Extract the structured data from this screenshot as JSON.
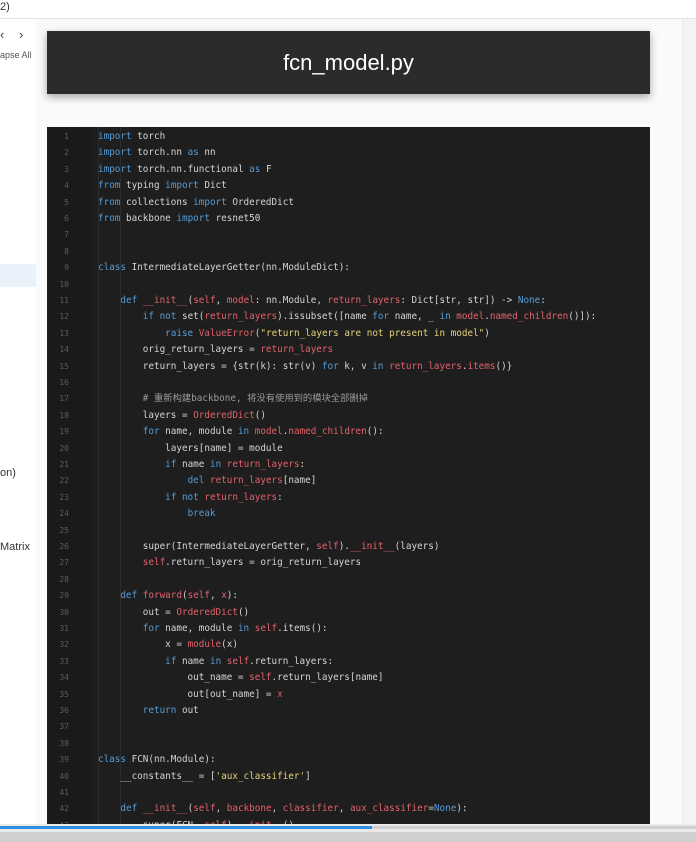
{
  "window": {
    "title_fragment": "2)"
  },
  "sidebar": {
    "back_glyph": "‹",
    "forward_glyph": "›",
    "collapse_label": "apse All",
    "item_on": "on)",
    "item_matrix": "Matrix"
  },
  "document": {
    "title": "fcn_model.py"
  },
  "code": {
    "language": "python",
    "lines": [
      [
        [
          "kw",
          "import"
        ],
        [
          "t",
          " torch"
        ]
      ],
      [
        [
          "kw",
          "import"
        ],
        [
          "t",
          " torch.nn "
        ],
        [
          "kw",
          "as"
        ],
        [
          "t",
          " nn"
        ]
      ],
      [
        [
          "kw",
          "import"
        ],
        [
          "t",
          " torch.nn.functional "
        ],
        [
          "kw",
          "as"
        ],
        [
          "t",
          " F"
        ]
      ],
      [
        [
          "kw",
          "from"
        ],
        [
          "t",
          " typing "
        ],
        [
          "kw",
          "import"
        ],
        [
          "t",
          " Dict"
        ]
      ],
      [
        [
          "kw",
          "from"
        ],
        [
          "t",
          " collections "
        ],
        [
          "kw",
          "import"
        ],
        [
          "t",
          " OrderedDict"
        ]
      ],
      [
        [
          "kw",
          "from"
        ],
        [
          "t",
          " backbone "
        ],
        [
          "kw",
          "import"
        ],
        [
          "t",
          " resnet50"
        ]
      ],
      [],
      [],
      [
        [
          "kw",
          "class"
        ],
        [
          "t",
          " IntermediateLayerGetter(nn.ModuleDict):"
        ]
      ],
      [],
      [
        [
          "t",
          "    "
        ],
        [
          "kw",
          "def"
        ],
        [
          "t",
          " "
        ],
        [
          "red",
          "__init__"
        ],
        [
          "t",
          "("
        ],
        [
          "red",
          "self"
        ],
        [
          "t",
          ", "
        ],
        [
          "red",
          "model"
        ],
        [
          "t",
          ": nn.Module, "
        ],
        [
          "red",
          "return_layers"
        ],
        [
          "t",
          ": Dict[str, str]) -> "
        ],
        [
          "kw",
          "None"
        ],
        [
          "t",
          ":"
        ]
      ],
      [
        [
          "t",
          "        "
        ],
        [
          "kw",
          "if not"
        ],
        [
          "t",
          " set("
        ],
        [
          "red",
          "return_layers"
        ],
        [
          "t",
          ").issubset([name "
        ],
        [
          "kw",
          "for"
        ],
        [
          "t",
          " name, _ "
        ],
        [
          "kw",
          "in"
        ],
        [
          "t",
          " "
        ],
        [
          "red",
          "model"
        ],
        [
          "t",
          "."
        ],
        [
          "red",
          "named_children"
        ],
        [
          "t",
          "()]):"
        ]
      ],
      [
        [
          "t",
          "            "
        ],
        [
          "kw",
          "raise"
        ],
        [
          "t",
          " "
        ],
        [
          "red",
          "ValueError"
        ],
        [
          "t",
          "("
        ],
        [
          "str",
          "\"return_layers are not present in model\""
        ],
        [
          "t",
          ")"
        ]
      ],
      [
        [
          "t",
          "        orig_return_layers = "
        ],
        [
          "red",
          "return_layers"
        ]
      ],
      [
        [
          "t",
          "        return_layers = {str(k): str(v) "
        ],
        [
          "kw",
          "for"
        ],
        [
          "t",
          " k, v "
        ],
        [
          "kw",
          "in"
        ],
        [
          "t",
          " "
        ],
        [
          "red",
          "return_layers"
        ],
        [
          "t",
          "."
        ],
        [
          "red",
          "items"
        ],
        [
          "t",
          "()}"
        ]
      ],
      [],
      [
        [
          "t",
          "        "
        ],
        [
          "cm",
          "# 重新构建backbone, 将没有使用到的模块全部删掉"
        ]
      ],
      [
        [
          "t",
          "        layers = "
        ],
        [
          "red",
          "OrderedDict"
        ],
        [
          "t",
          "()"
        ]
      ],
      [
        [
          "t",
          "        "
        ],
        [
          "kw",
          "for"
        ],
        [
          "t",
          " name, module "
        ],
        [
          "kw",
          "in"
        ],
        [
          "t",
          " "
        ],
        [
          "red",
          "model"
        ],
        [
          "t",
          "."
        ],
        [
          "red",
          "named_children"
        ],
        [
          "t",
          "():"
        ]
      ],
      [
        [
          "t",
          "            layers[name] = module"
        ]
      ],
      [
        [
          "t",
          "            "
        ],
        [
          "kw",
          "if"
        ],
        [
          "t",
          " name "
        ],
        [
          "kw",
          "in"
        ],
        [
          "t",
          " "
        ],
        [
          "red",
          "return_layers"
        ],
        [
          "t",
          ":"
        ]
      ],
      [
        [
          "t",
          "                "
        ],
        [
          "kw",
          "del"
        ],
        [
          "t",
          " "
        ],
        [
          "red",
          "return_layers"
        ],
        [
          "t",
          "[name]"
        ]
      ],
      [
        [
          "t",
          "            "
        ],
        [
          "kw",
          "if not"
        ],
        [
          "t",
          " "
        ],
        [
          "red",
          "return_layers"
        ],
        [
          "t",
          ":"
        ]
      ],
      [
        [
          "t",
          "                "
        ],
        [
          "kw",
          "break"
        ]
      ],
      [],
      [
        [
          "t",
          "        super(IntermediateLayerGetter, "
        ],
        [
          "red",
          "self"
        ],
        [
          "t",
          ")."
        ],
        [
          "red",
          "__init__"
        ],
        [
          "t",
          "(layers)"
        ]
      ],
      [
        [
          "t",
          "        "
        ],
        [
          "red",
          "self"
        ],
        [
          "t",
          ".return_layers = orig_return_layers"
        ]
      ],
      [],
      [
        [
          "t",
          "    "
        ],
        [
          "kw",
          "def"
        ],
        [
          "t",
          " "
        ],
        [
          "red",
          "forward"
        ],
        [
          "t",
          "("
        ],
        [
          "red",
          "self"
        ],
        [
          "t",
          ", "
        ],
        [
          "red",
          "x"
        ],
        [
          "t",
          "):"
        ]
      ],
      [
        [
          "t",
          "        out = "
        ],
        [
          "red",
          "OrderedDict"
        ],
        [
          "t",
          "()"
        ]
      ],
      [
        [
          "t",
          "        "
        ],
        [
          "kw",
          "for"
        ],
        [
          "t",
          " name, module "
        ],
        [
          "kw",
          "in"
        ],
        [
          "t",
          " "
        ],
        [
          "red",
          "self"
        ],
        [
          "t",
          ".items():"
        ]
      ],
      [
        [
          "t",
          "            x = "
        ],
        [
          "red",
          "module"
        ],
        [
          "t",
          "(x)"
        ]
      ],
      [
        [
          "t",
          "            "
        ],
        [
          "kw",
          "if"
        ],
        [
          "t",
          " name "
        ],
        [
          "kw",
          "in"
        ],
        [
          "t",
          " "
        ],
        [
          "red",
          "self"
        ],
        [
          "t",
          ".return_layers:"
        ]
      ],
      [
        [
          "t",
          "                out_name = "
        ],
        [
          "red",
          "self"
        ],
        [
          "t",
          ".return_layers[name]"
        ]
      ],
      [
        [
          "t",
          "                out[out_name] = "
        ],
        [
          "red",
          "x"
        ]
      ],
      [
        [
          "t",
          "        "
        ],
        [
          "kw",
          "return"
        ],
        [
          "t",
          " out"
        ]
      ],
      [],
      [],
      [
        [
          "kw",
          "class"
        ],
        [
          "t",
          " FCN(nn.Module):"
        ]
      ],
      [
        [
          "t",
          "    __constants__ = ["
        ],
        [
          "str",
          "'aux_classifier'"
        ],
        [
          "t",
          "]"
        ]
      ],
      [],
      [
        [
          "t",
          "    "
        ],
        [
          "kw",
          "def"
        ],
        [
          "t",
          " "
        ],
        [
          "red",
          "__init__"
        ],
        [
          "t",
          "("
        ],
        [
          "red",
          "self"
        ],
        [
          "t",
          ", "
        ],
        [
          "red",
          "backbone"
        ],
        [
          "t",
          ", "
        ],
        [
          "red",
          "classifier"
        ],
        [
          "t",
          ", "
        ],
        [
          "red",
          "aux_classifier"
        ],
        [
          "t",
          "="
        ],
        [
          "kw",
          "None"
        ],
        [
          "t",
          "):"
        ]
      ],
      [
        [
          "t",
          "        super(FCN, "
        ],
        [
          "red",
          "self"
        ],
        [
          "t",
          ")."
        ],
        [
          "red",
          "__init__"
        ],
        [
          "t",
          "()"
        ]
      ]
    ]
  },
  "colors": {
    "keyword": "#569cd6",
    "highlight": "#e3616b",
    "string": "#e4d37a",
    "comment": "#9a9a9a",
    "accent_progress": "#2f8ee0"
  }
}
